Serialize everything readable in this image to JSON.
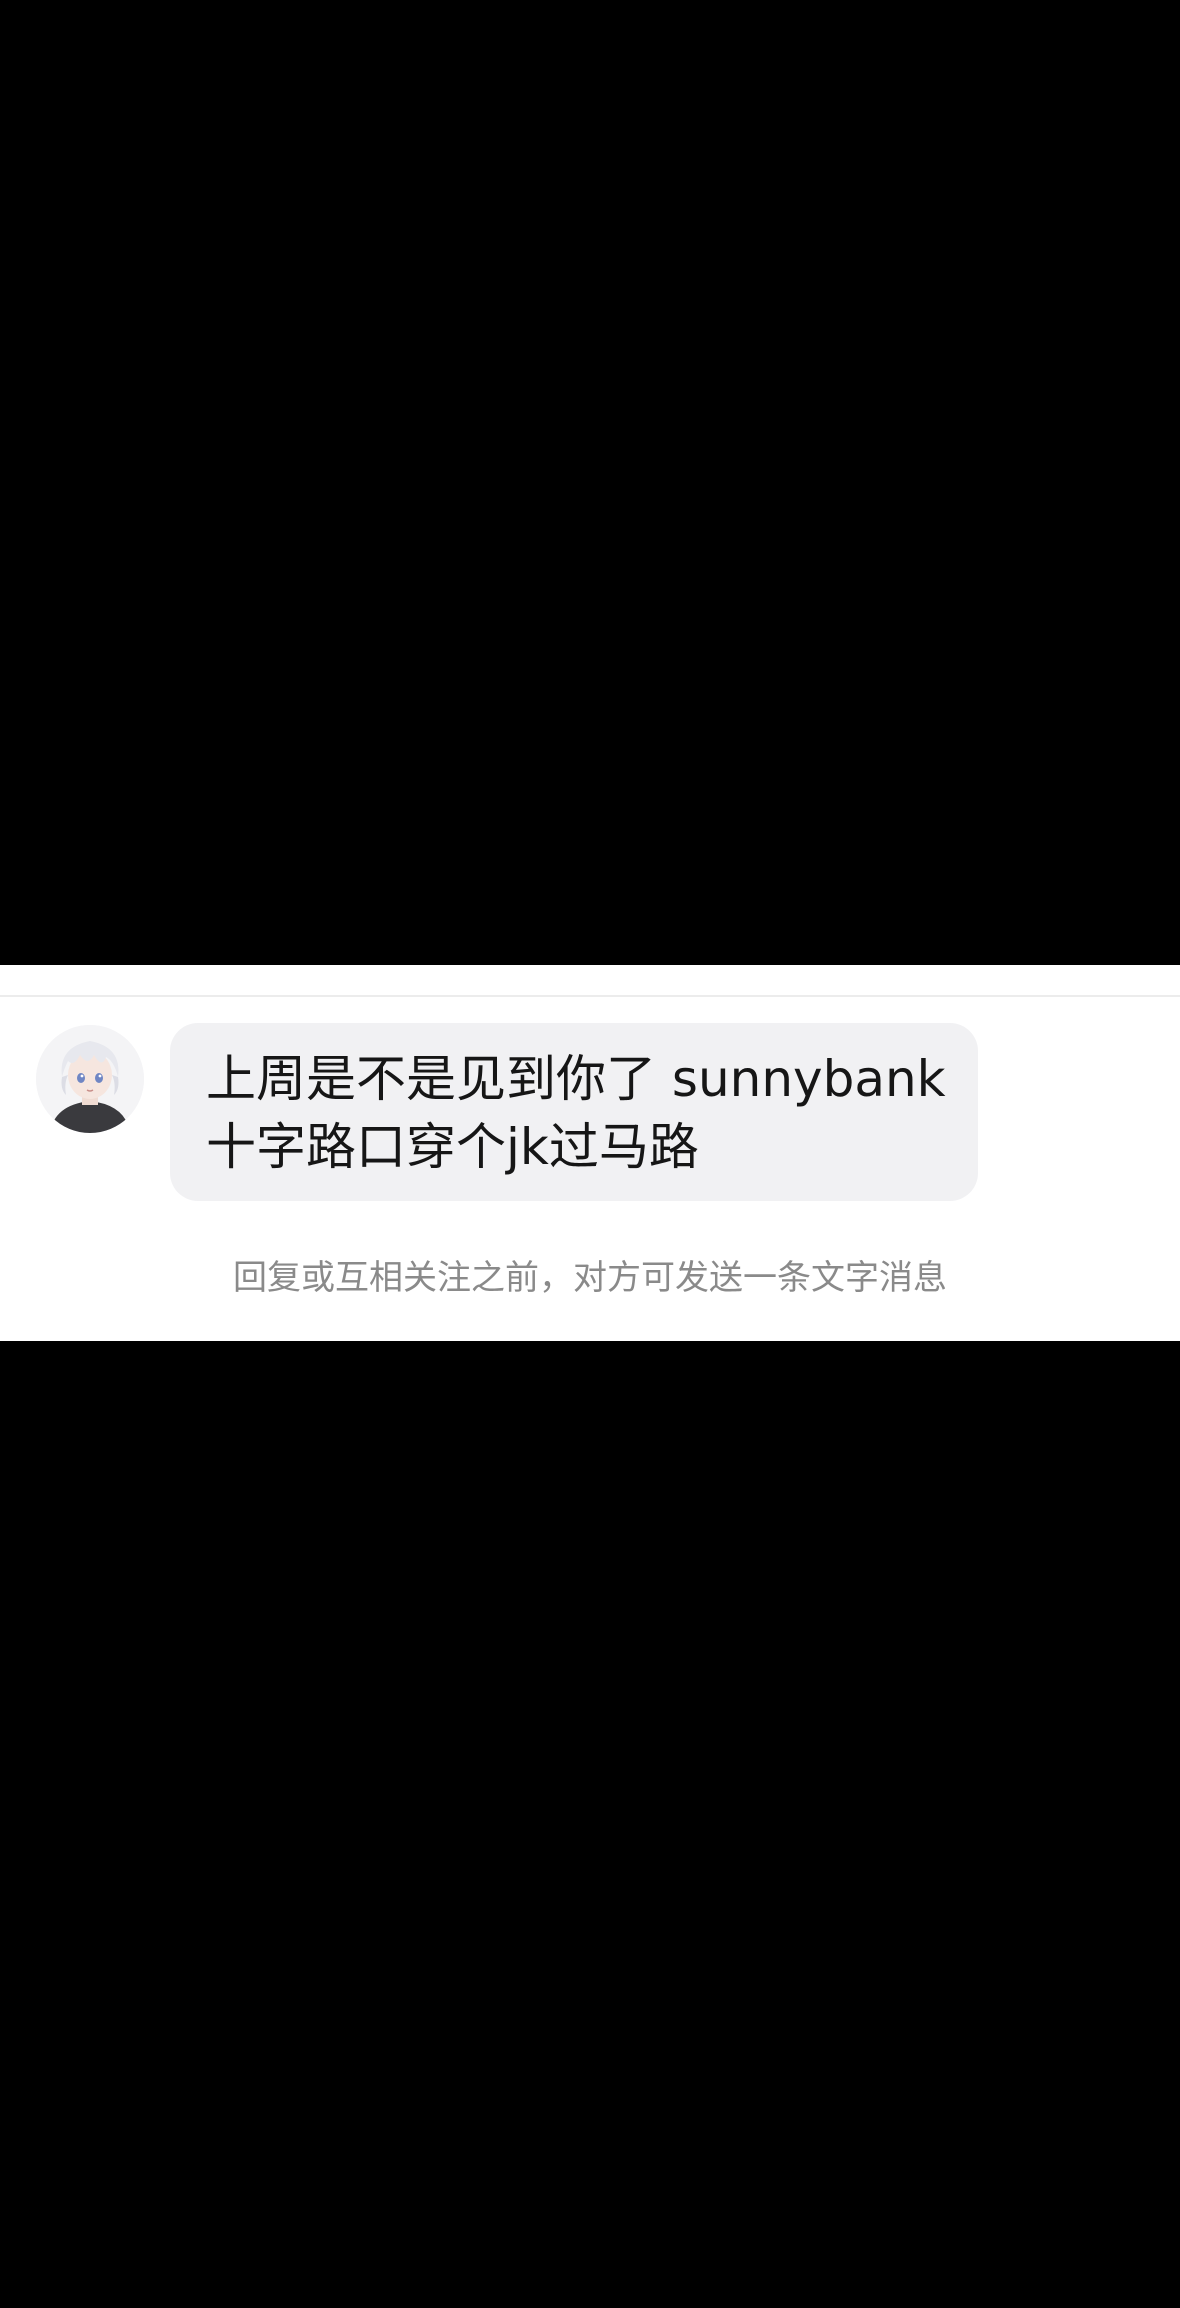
{
  "conversation": {
    "message": {
      "sender_avatar_icon": "anime-character-avatar-icon",
      "lines": [
        "上周是不是见到你了 sunnybank",
        "十字路口穿个jk过马路"
      ]
    },
    "notice_text": "回复或互相关注之前，对方可发送一条文字消息"
  },
  "colors": {
    "bubble_background": "#f1f1f3",
    "message_text": "#161616",
    "notice_text": "#8a8a8a",
    "panel_background": "#ffffff",
    "outer_background": "#000000"
  }
}
